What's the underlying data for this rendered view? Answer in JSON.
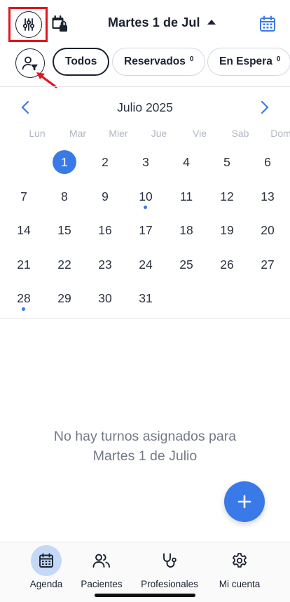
{
  "header": {
    "date_title": "Martes 1 de Jul"
  },
  "filters": {
    "chips": [
      {
        "label": "Todos",
        "count": ""
      },
      {
        "label": "Reservados",
        "count": "0"
      },
      {
        "label": "En Espera",
        "count": "0"
      }
    ],
    "active_chip": "Todos"
  },
  "calendar": {
    "month_title": "Julio 2025",
    "weekdays": [
      "Lun",
      "Mar",
      "Mier",
      "Jue",
      "Vie",
      "Sab",
      "Dom"
    ],
    "first_weekday_offset": 1,
    "days_in_month": 31,
    "selected_day": 1,
    "days_with_events": [
      10,
      28
    ]
  },
  "empty_state": {
    "line1": "No hay turnos asignados para",
    "line2": "Martes 1 de Julio"
  },
  "bottom_nav": {
    "items": [
      {
        "label": "Agenda",
        "icon": "calendar-icon",
        "active": true
      },
      {
        "label": "Pacientes",
        "icon": "users-icon",
        "active": false
      },
      {
        "label": "Profesionales",
        "icon": "stethoscope-icon",
        "active": false
      },
      {
        "label": "Mi cuenta",
        "icon": "gear-icon",
        "active": false
      }
    ]
  },
  "colors": {
    "accent": "#3a7ae8",
    "annotation_red": "#e3141b",
    "text": "#1b2230",
    "muted": "#737a86"
  }
}
